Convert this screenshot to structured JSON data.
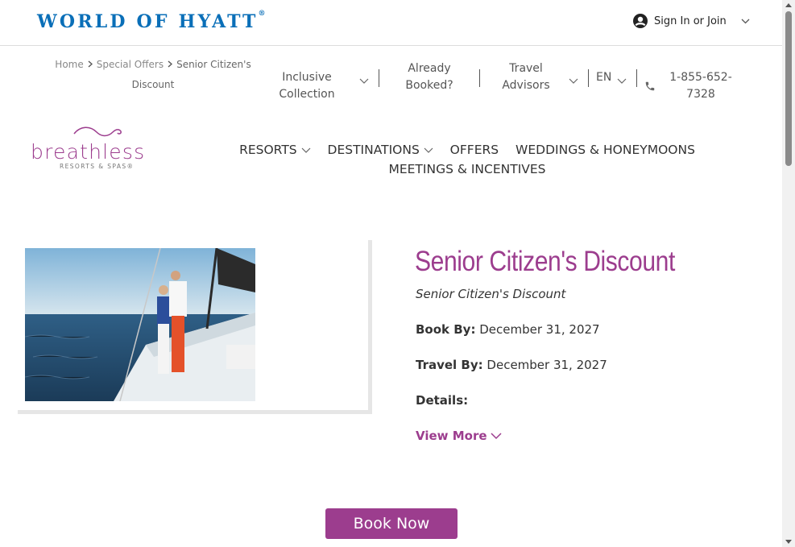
{
  "header": {
    "brand_logo": "WORLD OF HYATT",
    "brand_reg": "®",
    "signin_label": "Sign In or Join"
  },
  "breadcrumb": {
    "home": "Home",
    "special_offers": "Special Offers",
    "current": "Senior Citizen's Discount"
  },
  "utility_nav": {
    "inclusive_collection": "Inclusive Collection",
    "already_booked": "Already Booked?",
    "travel_advisors": "Travel Advisors",
    "language": "EN",
    "phone": "1-855-652-7328"
  },
  "brand": {
    "name": "breathless",
    "subtitle": "RESORTS & SPAS®"
  },
  "main_nav": {
    "resorts": "RESORTS",
    "destinations": "DESTINATIONS",
    "offers": "OFFERS",
    "weddings": "WEDDINGS & HONEYMOONS",
    "meetings": "MEETINGS & INCENTIVES"
  },
  "offer": {
    "title": "Senior Citizen's Discount",
    "subtitle": "Senior Citizen's Discount",
    "book_by_label": "Book By:",
    "book_by_value": "December 31, 2027",
    "travel_by_label": "Travel By:",
    "travel_by_value": "December 31, 2027",
    "details_label": "Details:",
    "view_more": "View More",
    "book_now": "Book Now"
  },
  "colors": {
    "hyatt_blue": "#0a6fb8",
    "brand_purple": "#9c3d8e"
  }
}
